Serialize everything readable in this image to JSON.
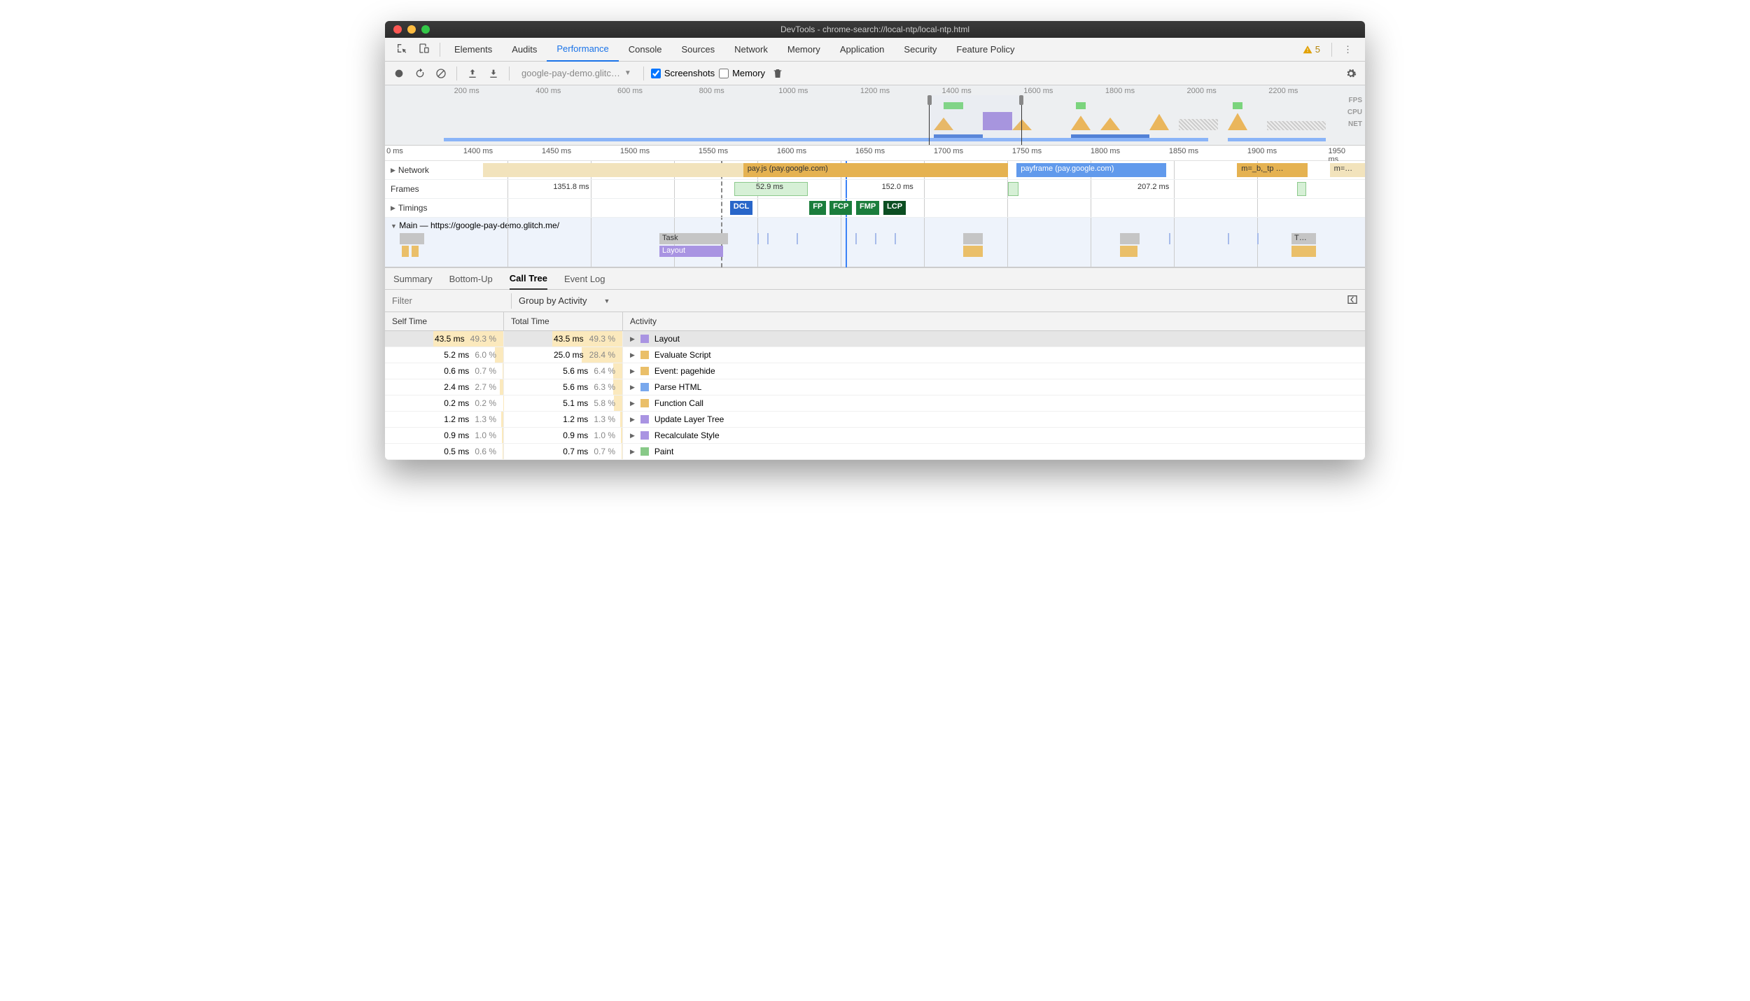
{
  "window": {
    "title": "DevTools - chrome-search://local-ntp/local-ntp.html"
  },
  "mainTabs": [
    "Elements",
    "Audits",
    "Performance",
    "Console",
    "Sources",
    "Network",
    "Memory",
    "Application",
    "Security",
    "Feature Policy"
  ],
  "activeTab": "Performance",
  "warningCount": "5",
  "toolbar": {
    "profileName": "google-pay-demo.glitc…",
    "screenshots": "Screenshots",
    "memory": "Memory"
  },
  "overview": {
    "ticks": [
      "200 ms",
      "400 ms",
      "600 ms",
      "800 ms",
      "1000 ms",
      "1200 ms",
      "1400 ms",
      "1600 ms",
      "1800 ms",
      "2000 ms",
      "2200 ms"
    ],
    "labels": [
      "FPS",
      "CPU",
      "NET"
    ]
  },
  "flameRuler": [
    "0 ms",
    "1400 ms",
    "1450 ms",
    "1500 ms",
    "1550 ms",
    "1600 ms",
    "1650 ms",
    "1700 ms",
    "1750 ms",
    "1800 ms",
    "1850 ms",
    "1900 ms",
    "1950 ms"
  ],
  "tracks": {
    "network": {
      "label": "Network",
      "items": [
        {
          "text": "pay.js (pay.google.com)"
        },
        {
          "text": "payframe (pay.google.com)"
        },
        {
          "text": "m=_b,_tp …"
        },
        {
          "text": "m=…"
        }
      ]
    },
    "frames": {
      "label": "Frames",
      "values": [
        "1351.8 ms",
        "52.9 ms",
        "152.0 ms",
        "207.2 ms"
      ]
    },
    "timings": {
      "label": "Timings",
      "badges": [
        "DCL",
        "FP",
        "FCP",
        "FMP",
        "LCP"
      ]
    },
    "main": {
      "label": "Main — https://google-pay-demo.glitch.me/",
      "task": "Task",
      "layout": "Layout",
      "taskShort": "T…"
    }
  },
  "bottomTabs": [
    "Summary",
    "Bottom-Up",
    "Call Tree",
    "Event Log"
  ],
  "activeBottomTab": "Call Tree",
  "filter": {
    "placeholder": "Filter",
    "group": "Group by Activity"
  },
  "table": {
    "headers": {
      "self": "Self Time",
      "total": "Total Time",
      "activity": "Activity"
    },
    "rows": [
      {
        "self_ms": "43.5 ms",
        "self_pct": "49.3 %",
        "total_ms": "43.5 ms",
        "total_pct": "49.3 %",
        "color": "purple",
        "activity": "Layout",
        "selected": true
      },
      {
        "self_ms": "5.2 ms",
        "self_pct": "6.0 %",
        "total_ms": "25.0 ms",
        "total_pct": "28.4 %",
        "color": "yellow",
        "activity": "Evaluate Script"
      },
      {
        "self_ms": "0.6 ms",
        "self_pct": "0.7 %",
        "total_ms": "5.6 ms",
        "total_pct": "6.4 %",
        "color": "yellow",
        "activity": "Event: pagehide"
      },
      {
        "self_ms": "2.4 ms",
        "self_pct": "2.7 %",
        "total_ms": "5.6 ms",
        "total_pct": "6.3 %",
        "color": "blue",
        "activity": "Parse HTML"
      },
      {
        "self_ms": "0.2 ms",
        "self_pct": "0.2 %",
        "total_ms": "5.1 ms",
        "total_pct": "5.8 %",
        "color": "yellow",
        "activity": "Function Call"
      },
      {
        "self_ms": "1.2 ms",
        "self_pct": "1.3 %",
        "total_ms": "1.2 ms",
        "total_pct": "1.3 %",
        "color": "purple",
        "activity": "Update Layer Tree"
      },
      {
        "self_ms": "0.9 ms",
        "self_pct": "1.0 %",
        "total_ms": "0.9 ms",
        "total_pct": "1.0 %",
        "color": "purple",
        "activity": "Recalculate Style"
      },
      {
        "self_ms": "0.5 ms",
        "self_pct": "0.6 %",
        "total_ms": "0.7 ms",
        "total_pct": "0.7 %",
        "color": "green",
        "activity": "Paint"
      }
    ]
  }
}
